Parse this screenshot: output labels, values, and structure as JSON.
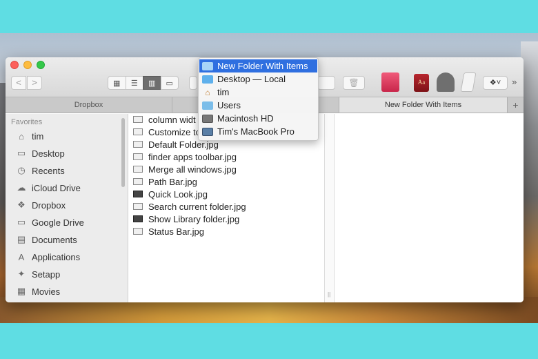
{
  "window": {
    "toolbar": {
      "nav_back": "<",
      "nav_forward": ">",
      "view_modes": [
        {
          "name": "icon-view",
          "glyph": "▦",
          "active": false
        },
        {
          "name": "list-view",
          "glyph": "☰",
          "active": false
        },
        {
          "name": "column-view",
          "glyph": "▥",
          "active": true
        },
        {
          "name": "gallery-view",
          "glyph": "▭",
          "active": false
        }
      ],
      "trash_glyph": "🗑",
      "dict_label": "Aa",
      "dropbox_glyph": "❖˅",
      "more_glyph": "»"
    },
    "tabs": [
      "Dropbox",
      "",
      "New Folder With Items"
    ],
    "tab_add": "+",
    "sidebar": {
      "header": "Favorites",
      "items": [
        {
          "label": "tim",
          "icon": "⌂"
        },
        {
          "label": "Desktop",
          "icon": "▭"
        },
        {
          "label": "Recents",
          "icon": "◷"
        },
        {
          "label": "iCloud Drive",
          "icon": "☁"
        },
        {
          "label": "Dropbox",
          "icon": "❖"
        },
        {
          "label": "Google Drive",
          "icon": "▭"
        },
        {
          "label": "Documents",
          "icon": "▤"
        },
        {
          "label": "Applications",
          "icon": "A"
        },
        {
          "label": "Setapp",
          "icon": "✦"
        },
        {
          "label": "Movies",
          "icon": "▦"
        }
      ]
    },
    "files": [
      {
        "label": "column widt",
        "dark": false
      },
      {
        "label": "Customize to",
        "dark": false
      },
      {
        "label": "Default Folder.jpg",
        "dark": false
      },
      {
        "label": "finder apps toolbar.jpg",
        "dark": false
      },
      {
        "label": "Merge all windows.jpg",
        "dark": false
      },
      {
        "label": "Path Bar.jpg",
        "dark": false
      },
      {
        "label": "Quick Look.jpg",
        "dark": true
      },
      {
        "label": "Search current folder.jpg",
        "dark": false
      },
      {
        "label": "Show Library folder.jpg",
        "dark": true
      },
      {
        "label": "Status Bar.jpg",
        "dark": false
      }
    ],
    "divider_grip": "||"
  },
  "path_menu": {
    "items": [
      {
        "label": "New Folder With Items",
        "icon": "folder",
        "selected": true
      },
      {
        "label": "Desktop — Local",
        "icon": "folder",
        "selected": false
      },
      {
        "label": "tim",
        "icon": "home",
        "selected": false
      },
      {
        "label": "Users",
        "icon": "users",
        "selected": false
      },
      {
        "label": "Macintosh HD",
        "icon": "hd",
        "selected": false
      },
      {
        "label": "Tim's MacBook Pro",
        "icon": "mac",
        "selected": false
      }
    ]
  },
  "colors": {
    "accent": "#2f6fe0",
    "frame": "#5fdde3"
  }
}
